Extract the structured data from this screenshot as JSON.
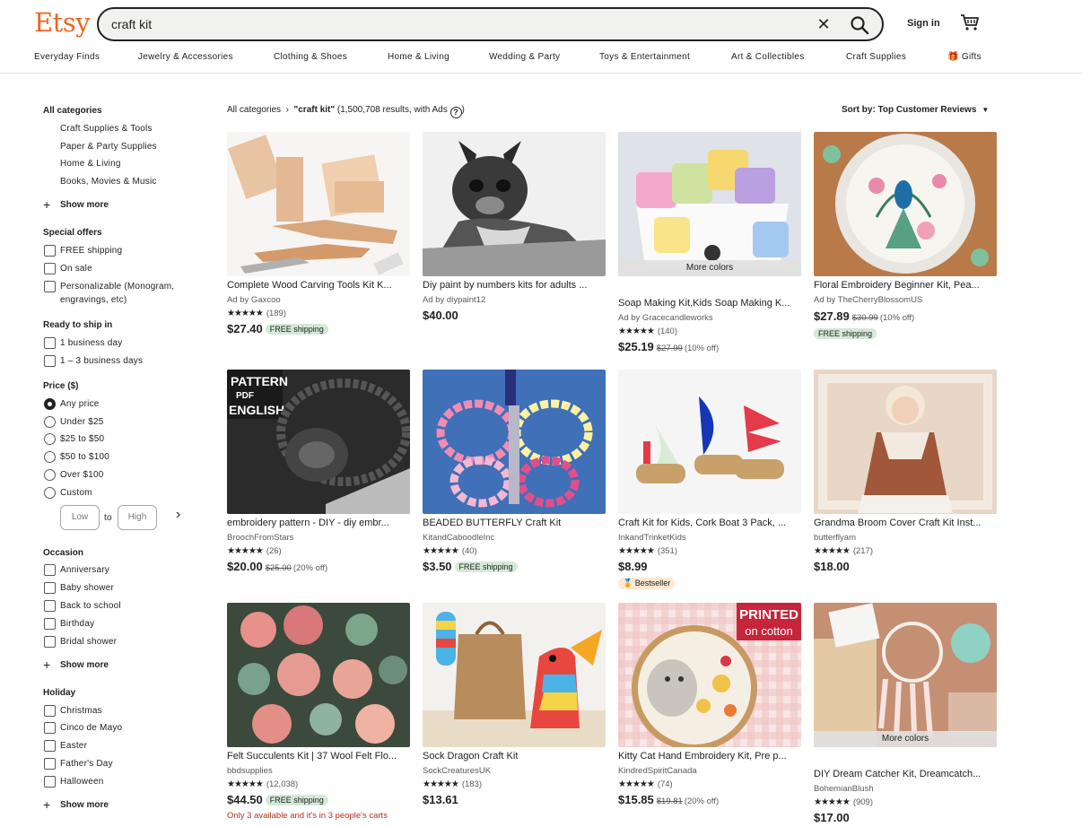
{
  "header": {
    "logo": "Etsy",
    "search_value": "craft kit",
    "clear_icon": "close-icon",
    "search_icon": "search-icon",
    "signin": "Sign in",
    "cart_icon": "cart-icon",
    "brand_color": "#f1641e"
  },
  "nav": [
    "Everyday Finds",
    "Jewelry & Accessories",
    "Clothing & Shoes",
    "Home & Living",
    "Wedding & Party",
    "Toys & Entertainment",
    "Art & Collectibles",
    "Craft Supplies",
    "Gifts"
  ],
  "sidebar": {
    "all_categories": "All categories",
    "categories": [
      "Craft Supplies & Tools",
      "Paper & Party Supplies",
      "Home & Living",
      "Books, Movies & Music"
    ],
    "show_more": "Show more",
    "special_offers": {
      "title": "Special offers",
      "options": [
        "FREE shipping",
        "On sale",
        "Personalizable (Monogram,",
        "engravings, etc)"
      ]
    },
    "ready_to_ship": {
      "title": "Ready to ship in",
      "options": [
        "1 business day",
        "1 – 3 business days"
      ]
    },
    "price": {
      "title": "Price ($)",
      "options": [
        "Any price",
        "Under $25",
        "$25 to $50",
        "$50 to $100",
        "Over $100",
        "Custom"
      ],
      "low_placeholder": "Low",
      "high_placeholder": "High",
      "to": "to"
    },
    "occasion": {
      "title": "Occasion",
      "options": [
        "Anniversary",
        "Baby shower",
        "Back to school",
        "Birthday",
        "Bridal shower"
      ]
    },
    "holiday": {
      "title": "Holiday",
      "options": [
        "Christmas",
        "Cinco de Mayo",
        "Easter",
        "Father's Day",
        "Halloween"
      ]
    }
  },
  "breadcrumb": {
    "root": "All categories",
    "sep": "›",
    "query": "\"craft kit\"",
    "results": "(1,500,708 results, with Ads",
    "close_paren": ")",
    "help": "?"
  },
  "sort": {
    "label": "Sort by: Top Customer Reviews",
    "caret": "▼"
  },
  "listings": [
    {
      "title": "Complete Wood Carving Tools Kit K...",
      "shop": "Ad by Gaxcoo",
      "rating": "(189)",
      "price": "$27.40",
      "free": "FREE shipping"
    },
    {
      "title": "Diy paint by numbers kits for adults ...",
      "shop": "Ad by diypaint12",
      "price": "$40.00"
    },
    {
      "title": "Soap Making Kit,Kids Soap Making K...",
      "shop": "Ad by Gracecandleworks",
      "rating": "(140)",
      "price": "$25.19",
      "orig": "$27.99",
      "off": "(10% off)",
      "more_colors": "More colors"
    },
    {
      "title": "Floral Embroidery Beginner Kit, Pea...",
      "shop": "Ad by TheCherryBlossomUS",
      "price": "$27.89",
      "orig": "$30.99",
      "off": "(10% off)",
      "free": "FREE shipping"
    },
    {
      "title": "embroidery pattern - DIY - diy embr...",
      "shop": "BroochFromStars",
      "rating": "(26)",
      "price": "$20.00",
      "orig": "$25.00",
      "off": "(20% off)"
    },
    {
      "title": "BEADED BUTTERFLY Craft Kit",
      "shop": "KitandCaboodleInc",
      "rating": "(40)",
      "price": "$3.50",
      "free": "FREE shipping"
    },
    {
      "title": "Craft Kit for Kids, Cork Boat 3 Pack, ...",
      "shop": "InkandTrinketKids",
      "rating": "(351)",
      "price": "$8.99",
      "bestseller": "Bestseller"
    },
    {
      "title": "Grandma Broom Cover Craft Kit Inst...",
      "shop": "butterflyam",
      "rating": "(217)",
      "price": "$18.00"
    },
    {
      "title": "Felt Succulents Kit | 37 Wool Felt Flo...",
      "shop": "bbdsupplies",
      "rating": "(12,038)",
      "price": "$44.50",
      "free": "FREE shipping",
      "urgent": "Only 3 available and it's in 3 people's carts"
    },
    {
      "title": "Sock Dragon Craft Kit",
      "shop": "SockCreaturesUK",
      "rating": "(183)",
      "price": "$13.61"
    },
    {
      "title": "Kitty Cat Hand Embroidery Kit, Pre p...",
      "shop": "KindredSpiritCanada",
      "rating": "(74)",
      "price": "$15.85",
      "orig": "$19.81",
      "off": "(20% off)",
      "image_text_1": "PRINTED",
      "image_text_2": "on cotton"
    },
    {
      "title": "DIY Dream Catcher Kit, Dreamcatch...",
      "shop": "BohemianBlush",
      "rating": "(909)",
      "price": "$17.00",
      "more_colors": "More colors"
    }
  ],
  "stars": "★★★★★"
}
